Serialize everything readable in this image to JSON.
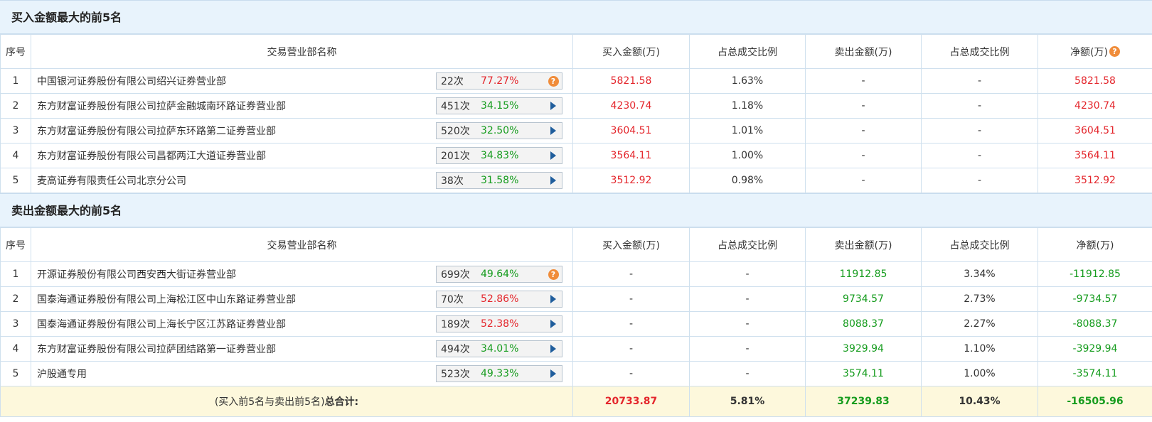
{
  "buy_section": {
    "title": "买入金额最大的前5名",
    "headers": [
      "序号",
      "交易营业部名称",
      "买入金额(万)",
      "占总成交比例",
      "卖出金额(万)",
      "占总成交比例",
      "净额(万)"
    ],
    "header_help_icon": "question-icon",
    "rows": [
      {
        "idx": "1",
        "name": "中国银河证券股份有限公司绍兴证券营业部",
        "count": "22次",
        "pct": "77.27%",
        "pct_color": "red",
        "icon": "question-icon",
        "buy": "5821.58",
        "buy_ratio": "1.63%",
        "sell": "-",
        "sell_ratio": "-",
        "net": "5821.58"
      },
      {
        "idx": "2",
        "name": "东方财富证券股份有限公司拉萨金融城南环路证券营业部",
        "count": "451次",
        "pct": "34.15%",
        "pct_color": "green",
        "icon": "arrow-right-icon",
        "buy": "4230.74",
        "buy_ratio": "1.18%",
        "sell": "-",
        "sell_ratio": "-",
        "net": "4230.74"
      },
      {
        "idx": "3",
        "name": "东方财富证券股份有限公司拉萨东环路第二证券营业部",
        "count": "520次",
        "pct": "32.50%",
        "pct_color": "green",
        "icon": "arrow-right-icon",
        "buy": "3604.51",
        "buy_ratio": "1.01%",
        "sell": "-",
        "sell_ratio": "-",
        "net": "3604.51"
      },
      {
        "idx": "4",
        "name": "东方财富证券股份有限公司昌都两江大道证券营业部",
        "count": "201次",
        "pct": "34.83%",
        "pct_color": "green",
        "icon": "arrow-right-icon",
        "buy": "3564.11",
        "buy_ratio": "1.00%",
        "sell": "-",
        "sell_ratio": "-",
        "net": "3564.11"
      },
      {
        "idx": "5",
        "name": "麦高证券有限责任公司北京分公司",
        "count": "38次",
        "pct": "31.58%",
        "pct_color": "green",
        "icon": "arrow-right-icon",
        "buy": "3512.92",
        "buy_ratio": "0.98%",
        "sell": "-",
        "sell_ratio": "-",
        "net": "3512.92"
      }
    ]
  },
  "sell_section": {
    "title": "卖出金额最大的前5名",
    "headers": [
      "序号",
      "交易营业部名称",
      "买入金额(万)",
      "占总成交比例",
      "卖出金额(万)",
      "占总成交比例",
      "净额(万)"
    ],
    "rows": [
      {
        "idx": "1",
        "name": "开源证券股份有限公司西安西大街证券营业部",
        "count": "699次",
        "pct": "49.64%",
        "pct_color": "green",
        "icon": "question-icon",
        "buy": "-",
        "buy_ratio": "-",
        "sell": "11912.85",
        "sell_ratio": "3.34%",
        "net": "-11912.85"
      },
      {
        "idx": "2",
        "name": "国泰海通证券股份有限公司上海松江区中山东路证券营业部",
        "count": "70次",
        "pct": "52.86%",
        "pct_color": "red",
        "icon": "arrow-right-icon",
        "buy": "-",
        "buy_ratio": "-",
        "sell": "9734.57",
        "sell_ratio": "2.73%",
        "net": "-9734.57"
      },
      {
        "idx": "3",
        "name": "国泰海通证券股份有限公司上海长宁区江苏路证券营业部",
        "count": "189次",
        "pct": "52.38%",
        "pct_color": "red",
        "icon": "arrow-right-icon",
        "buy": "-",
        "buy_ratio": "-",
        "sell": "8088.37",
        "sell_ratio": "2.27%",
        "net": "-8088.37"
      },
      {
        "idx": "4",
        "name": "东方财富证券股份有限公司拉萨团结路第一证券营业部",
        "count": "494次",
        "pct": "34.01%",
        "pct_color": "green",
        "icon": "arrow-right-icon",
        "buy": "-",
        "buy_ratio": "-",
        "sell": "3929.94",
        "sell_ratio": "1.10%",
        "net": "-3929.94"
      },
      {
        "idx": "5",
        "name": "沪股通专用",
        "count": "523次",
        "pct": "49.33%",
        "pct_color": "green",
        "icon": "arrow-right-icon",
        "buy": "-",
        "buy_ratio": "-",
        "sell": "3574.11",
        "sell_ratio": "1.00%",
        "net": "-3574.11"
      }
    ]
  },
  "summary": {
    "label_prefix": "(买入前5名与卖出前5名)",
    "label_strong": "总合计:",
    "buy_total": "20733.87",
    "buy_ratio": "5.81%",
    "sell_total": "37239.83",
    "sell_ratio": "10.43%",
    "net_total": "-16505.96"
  },
  "colors": {
    "positive": "#e4262c",
    "negative": "#169c1e",
    "header_bg": "#e8f3fc",
    "summary_bg": "#fdf8dc"
  }
}
